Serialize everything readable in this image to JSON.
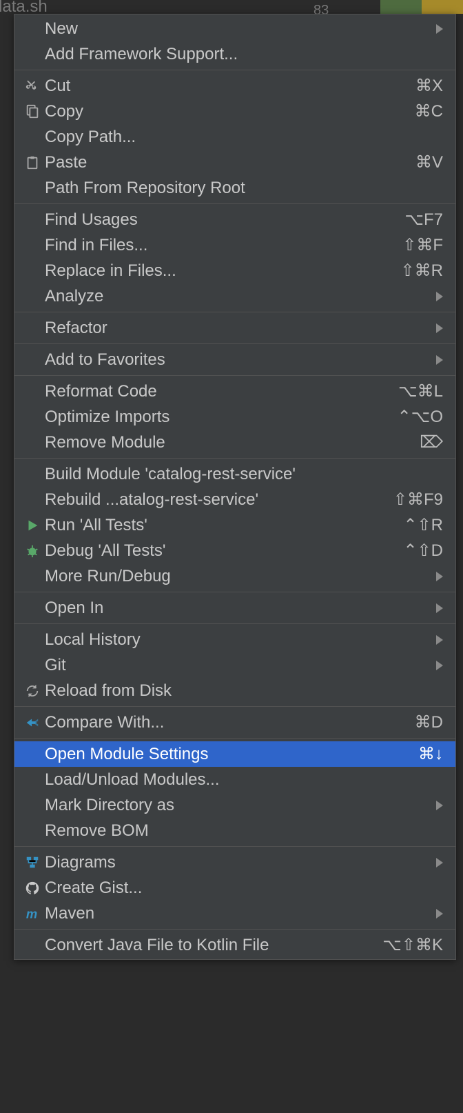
{
  "backdrop": {
    "filename_fragment": "...tadata.sh",
    "line_number": "83"
  },
  "menu": {
    "groups": [
      [
        {
          "id": "new",
          "label": "New",
          "icon": null,
          "shortcut": null,
          "submenu": true
        },
        {
          "id": "add-framework",
          "label": "Add Framework Support...",
          "icon": null,
          "shortcut": null,
          "submenu": false
        }
      ],
      [
        {
          "id": "cut",
          "label": "Cut",
          "icon": "cut",
          "shortcut": "⌘X",
          "submenu": false
        },
        {
          "id": "copy",
          "label": "Copy",
          "icon": "copy",
          "shortcut": "⌘C",
          "submenu": false
        },
        {
          "id": "copy-path",
          "label": "Copy Path...",
          "icon": null,
          "shortcut": null,
          "submenu": false
        },
        {
          "id": "paste",
          "label": "Paste",
          "icon": "paste",
          "shortcut": "⌘V",
          "submenu": false
        },
        {
          "id": "path-repo-root",
          "label": "Path From Repository Root",
          "icon": null,
          "shortcut": null,
          "submenu": false
        }
      ],
      [
        {
          "id": "find-usages",
          "label": "Find Usages",
          "icon": null,
          "shortcut": "⌥F7",
          "submenu": false
        },
        {
          "id": "find-in-files",
          "label": "Find in Files...",
          "icon": null,
          "shortcut": "⇧⌘F",
          "submenu": false
        },
        {
          "id": "replace-in-files",
          "label": "Replace in Files...",
          "icon": null,
          "shortcut": "⇧⌘R",
          "submenu": false
        },
        {
          "id": "analyze",
          "label": "Analyze",
          "icon": null,
          "shortcut": null,
          "submenu": true
        }
      ],
      [
        {
          "id": "refactor",
          "label": "Refactor",
          "icon": null,
          "shortcut": null,
          "submenu": true
        }
      ],
      [
        {
          "id": "add-favorites",
          "label": "Add to Favorites",
          "icon": null,
          "shortcut": null,
          "submenu": true
        }
      ],
      [
        {
          "id": "reformat",
          "label": "Reformat Code",
          "icon": null,
          "shortcut": "⌥⌘L",
          "submenu": false
        },
        {
          "id": "optimize-imports",
          "label": "Optimize Imports",
          "icon": null,
          "shortcut": "⌃⌥O",
          "submenu": false
        },
        {
          "id": "remove-module",
          "label": "Remove Module",
          "icon": null,
          "shortcut": "⌦",
          "submenu": false
        }
      ],
      [
        {
          "id": "build-module",
          "label": "Build Module 'catalog-rest-service'",
          "icon": null,
          "shortcut": null,
          "submenu": false
        },
        {
          "id": "rebuild",
          "label": "Rebuild ...atalog-rest-service'",
          "icon": null,
          "shortcut": "⇧⌘F9",
          "submenu": false
        },
        {
          "id": "run-all",
          "label": "Run 'All Tests'",
          "icon": "run",
          "shortcut": "⌃⇧R",
          "submenu": false
        },
        {
          "id": "debug-all",
          "label": "Debug 'All Tests'",
          "icon": "debug",
          "shortcut": "⌃⇧D",
          "submenu": false
        },
        {
          "id": "more-run",
          "label": "More Run/Debug",
          "icon": null,
          "shortcut": null,
          "submenu": true
        }
      ],
      [
        {
          "id": "open-in",
          "label": "Open In",
          "icon": null,
          "shortcut": null,
          "submenu": true
        }
      ],
      [
        {
          "id": "local-history",
          "label": "Local History",
          "icon": null,
          "shortcut": null,
          "submenu": true
        },
        {
          "id": "git",
          "label": "Git",
          "icon": null,
          "shortcut": null,
          "submenu": true
        },
        {
          "id": "reload-disk",
          "label": "Reload from Disk",
          "icon": "reload",
          "shortcut": null,
          "submenu": false
        }
      ],
      [
        {
          "id": "compare-with",
          "label": "Compare With...",
          "icon": "compare",
          "shortcut": "⌘D",
          "submenu": false
        }
      ],
      [
        {
          "id": "open-module-settings",
          "label": "Open Module Settings",
          "icon": null,
          "shortcut": "⌘↓",
          "submenu": false,
          "selected": true
        },
        {
          "id": "load-unload",
          "label": "Load/Unload Modules...",
          "icon": null,
          "shortcut": null,
          "submenu": false
        },
        {
          "id": "mark-directory",
          "label": "Mark Directory as",
          "icon": null,
          "shortcut": null,
          "submenu": true
        },
        {
          "id": "remove-bom",
          "label": "Remove BOM",
          "icon": null,
          "shortcut": null,
          "submenu": false
        }
      ],
      [
        {
          "id": "diagrams",
          "label": "Diagrams",
          "icon": "diagram",
          "shortcut": null,
          "submenu": true
        },
        {
          "id": "create-gist",
          "label": "Create Gist...",
          "icon": "github",
          "shortcut": null,
          "submenu": false
        },
        {
          "id": "maven",
          "label": "Maven",
          "icon": "maven",
          "shortcut": null,
          "submenu": true
        }
      ],
      [
        {
          "id": "convert-kotlin",
          "label": "Convert Java File to Kotlin File",
          "icon": null,
          "shortcut": "⌥⇧⌘K",
          "submenu": false
        }
      ]
    ]
  }
}
